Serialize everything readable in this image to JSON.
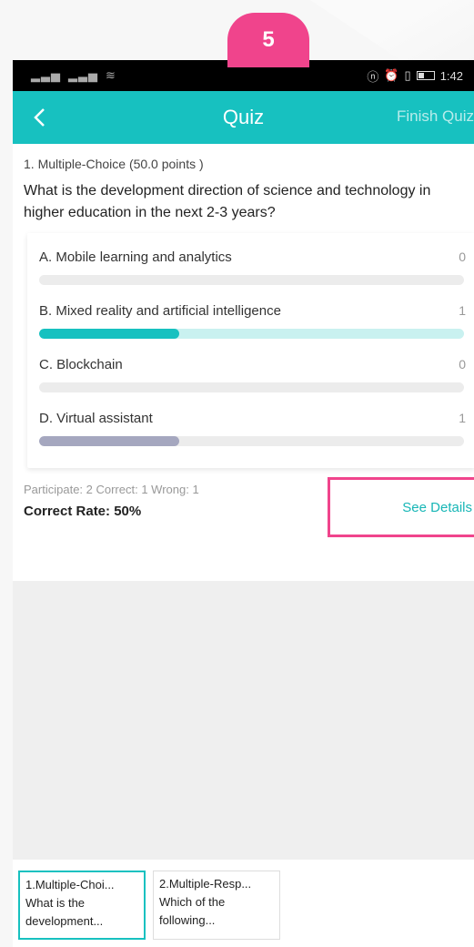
{
  "badge": "5",
  "status_bar": {
    "signal_left": "∷ıl ′ıl",
    "time": "1:42"
  },
  "nav": {
    "title": "Quiz",
    "finish_label": "Finish Quiz"
  },
  "question": {
    "type_label": "1. Multiple-Choice (50.0 points )",
    "text": "What is the development direction of science and technology in higher education in the next 2-3 years?",
    "options": [
      {
        "label": "A.  Mobile learning and analytics",
        "count": "0",
        "fill": 0,
        "color": "#e9e9e9"
      },
      {
        "label": "B.  Mixed reality and artificial intelligence",
        "count": "1",
        "fill": 0.33,
        "color": "#17c1c0",
        "track_color": "#c9f1f0"
      },
      {
        "label": "C.  Blockchain",
        "count": "0",
        "fill": 0,
        "color": "#e9e9e9"
      },
      {
        "label": "D.  Virtual assistant",
        "count": "1",
        "fill": 0.33,
        "color": "#a5a7bf"
      }
    ]
  },
  "summary": {
    "stats": "Participate: 2 Correct: 1 Wrong: 1",
    "correct_rate": "Correct Rate: 50%",
    "details_label": "See Details"
  },
  "tabs": [
    {
      "line1": "1.Multiple-Choi...",
      "line2": "What is the",
      "line3": "development...",
      "active": true
    },
    {
      "line1": "2.Multiple-Resp...",
      "line2": "Which of the",
      "line3": "following...",
      "active": false
    }
  ],
  "colors": {
    "accent": "#17c1c0",
    "highlight": "#f0448c"
  }
}
